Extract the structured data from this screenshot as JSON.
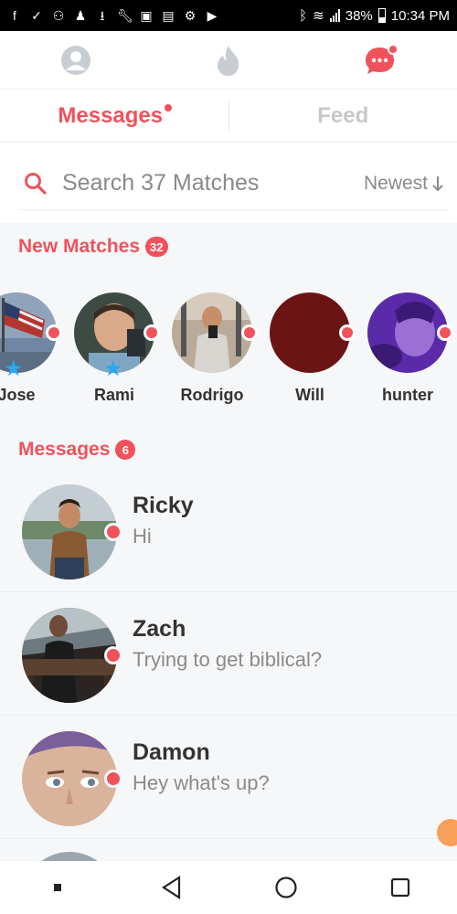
{
  "status_bar": {
    "battery": "38%",
    "time": "10:34 PM"
  },
  "nav": {
    "profile_icon": "profile-icon",
    "discover_icon": "flame-icon",
    "messages_icon": "chat-bubble-icon",
    "accent": "#f0525b"
  },
  "tabs": {
    "messages": "Messages",
    "feed": "Feed"
  },
  "search": {
    "placeholder": "Search 37 Matches",
    "sort_label": "Newest"
  },
  "new_matches": {
    "title": "New Matches",
    "count": "32",
    "items": [
      {
        "name": "Jose"
      },
      {
        "name": "Rami"
      },
      {
        "name": "Rodrigo"
      },
      {
        "name": "Will"
      },
      {
        "name": "hunter"
      }
    ]
  },
  "messages": {
    "title": "Messages",
    "count": "6",
    "items": [
      {
        "name": "Ricky",
        "preview": "Hi"
      },
      {
        "name": "Zach",
        "preview": "Trying to get biblical?"
      },
      {
        "name": "Damon",
        "preview": "Hey what's up?"
      }
    ]
  }
}
